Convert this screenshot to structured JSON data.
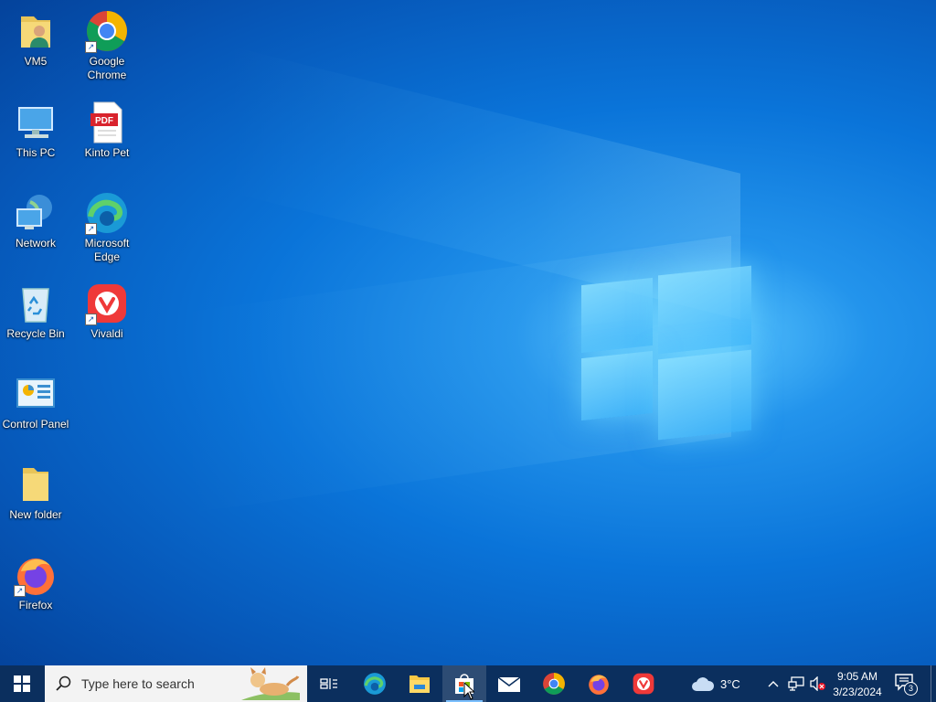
{
  "desktop": {
    "icons": [
      {
        "label_line1": "VM5",
        "label_line2": "",
        "icon": "user-folder-icon",
        "shortcut": false
      },
      {
        "label_line1": "Google",
        "label_line2": "Chrome",
        "icon": "chrome-icon",
        "shortcut": true
      },
      {
        "label_line1": "This PC",
        "label_line2": "",
        "icon": "this-pc-icon",
        "shortcut": false
      },
      {
        "label_line1": "Kinto Pet",
        "label_line2": "",
        "icon": "pdf-icon",
        "shortcut": false,
        "badge": "PDF"
      },
      {
        "label_line1": "Network",
        "label_line2": "",
        "icon": "network-icon",
        "shortcut": false
      },
      {
        "label_line1": "Microsoft",
        "label_line2": "Edge",
        "icon": "edge-icon",
        "shortcut": true
      },
      {
        "label_line1": "Recycle Bin",
        "label_line2": "",
        "icon": "recycle-bin-icon",
        "shortcut": false
      },
      {
        "label_line1": "Vivaldi",
        "label_line2": "",
        "icon": "vivaldi-icon",
        "shortcut": true
      },
      {
        "label_line1": "Control Panel",
        "label_line2": "",
        "icon": "control-panel-icon",
        "shortcut": false
      },
      {
        "label_line1": "New folder",
        "label_line2": "",
        "icon": "folder-icon",
        "shortcut": false
      },
      {
        "label_line1": "Firefox",
        "label_line2": "",
        "icon": "firefox-icon",
        "shortcut": true
      }
    ]
  },
  "taskbar": {
    "search_placeholder": "Type here to search",
    "apps": [
      "task-view-icon",
      "edge-icon",
      "file-explorer-icon",
      "microsoft-store-icon",
      "mail-icon",
      "chrome-icon",
      "firefox-icon",
      "vivaldi-icon"
    ],
    "active_app": "microsoft-store-icon",
    "weather": {
      "temp": "3°C",
      "icon": "cloud-icon"
    },
    "clock": {
      "time": "9:05 AM",
      "date": "3/23/2024"
    },
    "notifications": {
      "count": "3"
    }
  },
  "colors": {
    "taskbar": "#0b2f5e",
    "accent": "#0a74d9"
  }
}
